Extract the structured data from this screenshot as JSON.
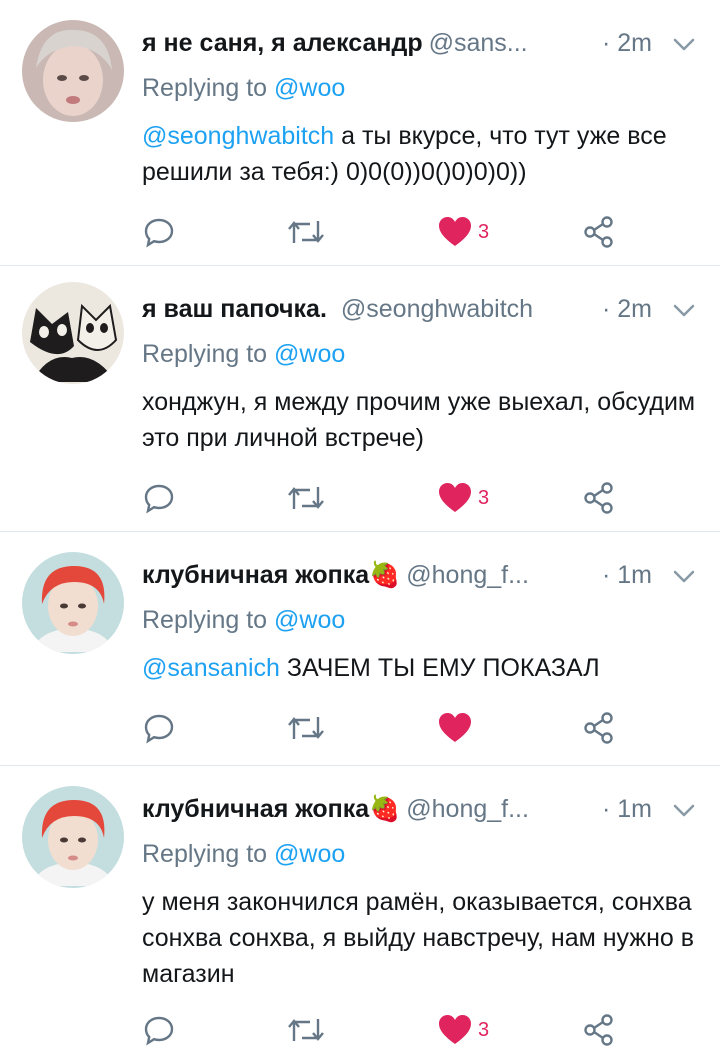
{
  "tweets": [
    {
      "name": "я не саня, я александр",
      "handle": "@sans...",
      "time": "· 2m",
      "replying_prefix": "Replying to ",
      "replying_to": "@woo",
      "mention": "@seonghwabitch",
      "text": " а ты вкурсе, что тут уже все решили за тебя:) 0)0(0))0()0)0)0))",
      "like_count": "3",
      "avatar": "user-avatar-blonde"
    },
    {
      "name": "я ваш папочка.",
      "handle": "@seonghwabitch",
      "time": "· 2m",
      "replying_prefix": "Replying to ",
      "replying_to": "@woo",
      "mention": "",
      "text": "хонджун, я между прочим уже выехал, обсудим это при личной встрече)",
      "like_count": "3",
      "avatar": "cats-avatar"
    },
    {
      "name": "клубничная жопка🍓",
      "handle": "@hong_f...",
      "time": "· 1m",
      "replying_prefix": "Replying to ",
      "replying_to": "@woo",
      "mention": "@sansanich",
      "text": " ЗАЧЕМ ТЫ ЕМУ ПОКАЗАЛ",
      "like_count": "",
      "avatar": "red-hair-avatar"
    },
    {
      "name": "клубничная жопка🍓",
      "handle": "@hong_f...",
      "time": "· 1m",
      "replying_prefix": "Replying to ",
      "replying_to": "@woo",
      "mention": "",
      "text": "у меня закончился рамён, оказывается, сонхва сонхва сонхва, я выйду навстречу, нам нужно в магазин",
      "like_count": "3",
      "avatar": "red-hair-avatar"
    }
  ],
  "colors": {
    "link": "#1da1f2",
    "secondary": "#657786",
    "like": "#e0245e",
    "divider": "#e1e8ed"
  }
}
